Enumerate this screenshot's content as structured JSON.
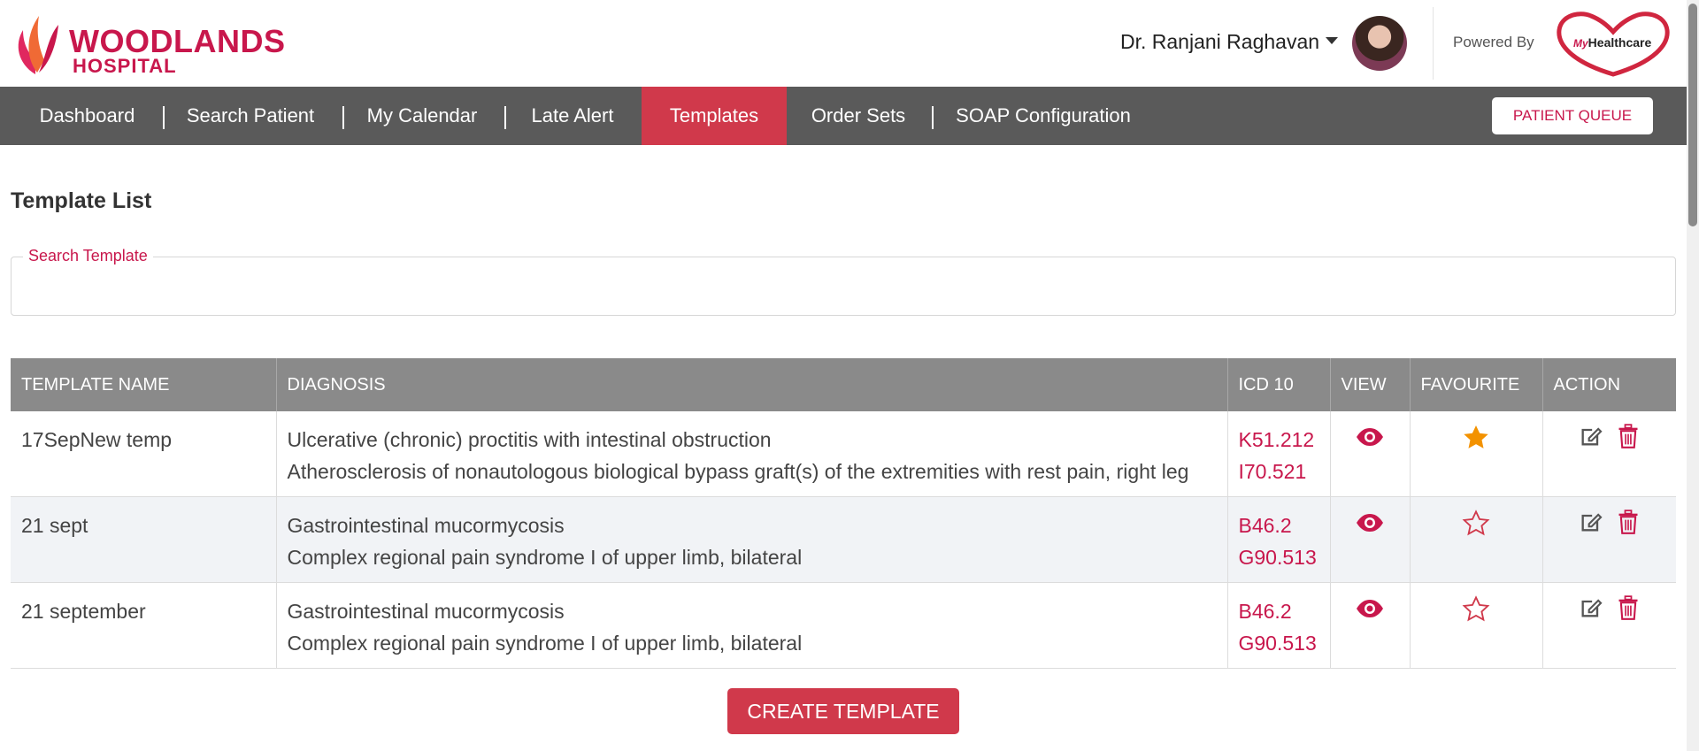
{
  "header": {
    "logo_line1": "WOODLANDS",
    "logo_line2": "HOSPITAL",
    "user_name": "Dr. Ranjani Raghavan",
    "powered_by": "Powered By",
    "partner_logo_prefix": "My",
    "partner_logo_text": "Healthcare"
  },
  "nav": {
    "items": [
      {
        "label": "Dashboard"
      },
      {
        "label": "Search Patient"
      },
      {
        "label": "My Calendar"
      },
      {
        "label": "Late Alert"
      },
      {
        "label": "Templates",
        "active": true
      },
      {
        "label": "Order Sets"
      },
      {
        "label": "SOAP Configuration"
      }
    ],
    "queue_button": "PATIENT QUEUE"
  },
  "page": {
    "title": "Template List",
    "search_legend": "Search Template",
    "search_value": ""
  },
  "table": {
    "headers": {
      "name": "TEMPLATE NAME",
      "diagnosis": "DIAGNOSIS",
      "icd": "ICD 10",
      "view": "VIEW",
      "favourite": "FAVOURITE",
      "action": "ACTION"
    },
    "rows": [
      {
        "name": "17SepNew temp",
        "diagnosis_1": "Ulcerative (chronic) proctitis with intestinal obstruction",
        "diagnosis_2": "Atherosclerosis of nonautologous biological bypass graft(s) of the extremities with rest pain, right leg",
        "icd_1": "K51.212",
        "icd_2": "I70.521",
        "favourite": true
      },
      {
        "name": "21 sept",
        "diagnosis_1": "Gastrointestinal mucormycosis",
        "diagnosis_2": "Complex regional pain syndrome I of upper limb, bilateral",
        "icd_1": "B46.2",
        "icd_2": "G90.513",
        "favourite": false
      },
      {
        "name": "21 september",
        "diagnosis_1": "Gastrointestinal mucormycosis",
        "diagnosis_2": "Complex regional pain syndrome I of upper limb, bilateral",
        "icd_1": "B46.2",
        "icd_2": "G90.513",
        "favourite": false
      }
    ]
  },
  "footer": {
    "create_button": "CREATE TEMPLATE"
  },
  "colors": {
    "brand": "#c8174c",
    "nav_bg": "#5a5a5a",
    "nav_active": "#d0394b",
    "table_header": "#8a8a8a",
    "star": "#f39200"
  },
  "icons": [
    "logo-flame-icon",
    "caret-down-icon",
    "eye-icon",
    "star-filled-icon",
    "star-outline-icon",
    "edit-icon",
    "trash-icon"
  ]
}
